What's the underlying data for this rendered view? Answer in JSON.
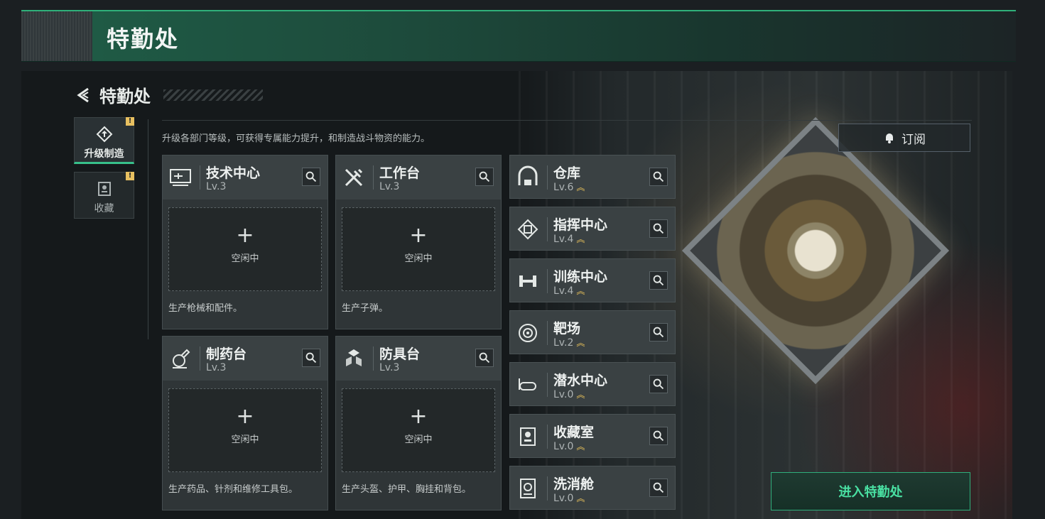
{
  "header": {
    "title": "特勤处"
  },
  "nav": {
    "back_title": "特勤处"
  },
  "side_tabs": [
    {
      "label": "升级制造",
      "icon": "upgrade-icon",
      "alert": "!",
      "active": true
    },
    {
      "label": "收藏",
      "icon": "collection-icon",
      "alert": "!",
      "active": false
    }
  ],
  "description": "升级各部门等级，可获得专属能力提升，和制造战斗物资的能力。",
  "workshops": [
    {
      "name": "技术中心",
      "level": "Lv.3",
      "icon": "tech-center-icon",
      "slot_plus": "+",
      "slot_status": "空闲中",
      "desc": "生产枪械和配件。"
    },
    {
      "name": "工作台",
      "level": "Lv.3",
      "icon": "workbench-icon",
      "slot_plus": "+",
      "slot_status": "空闲中",
      "desc": "生产子弹。"
    },
    {
      "name": "制药台",
      "level": "Lv.3",
      "icon": "pharmacy-icon",
      "slot_plus": "+",
      "slot_status": "空闲中",
      "desc": "生产药品、针剂和维修工具包。"
    },
    {
      "name": "防具台",
      "level": "Lv.3",
      "icon": "armor-bench-icon",
      "slot_plus": "+",
      "slot_status": "空闲中",
      "desc": "生产头盔、护甲、胸挂和背包。"
    }
  ],
  "departments": [
    {
      "name": "仓库",
      "level": "Lv.6",
      "icon": "warehouse-icon",
      "upgradable": true
    },
    {
      "name": "指挥中心",
      "level": "Lv.4",
      "icon": "command-center-icon",
      "upgradable": true
    },
    {
      "name": "训练中心",
      "level": "Lv.4",
      "icon": "training-center-icon",
      "upgradable": true
    },
    {
      "name": "靶场",
      "level": "Lv.2",
      "icon": "shooting-range-icon",
      "upgradable": true
    },
    {
      "name": "潜水中心",
      "level": "Lv.0",
      "icon": "diving-center-icon",
      "upgradable": true
    },
    {
      "name": "收藏室",
      "level": "Lv.0",
      "icon": "collection-room-icon",
      "upgradable": true
    },
    {
      "name": "洗消舱",
      "level": "Lv.0",
      "icon": "decontamination-icon",
      "upgradable": true
    }
  ],
  "buttons": {
    "subscribe": "订阅",
    "enter": "进入特勤处"
  },
  "colors": {
    "accent": "#37c08a",
    "upgrade_chevron": "#e9c25a",
    "alert": "#e8c060"
  }
}
